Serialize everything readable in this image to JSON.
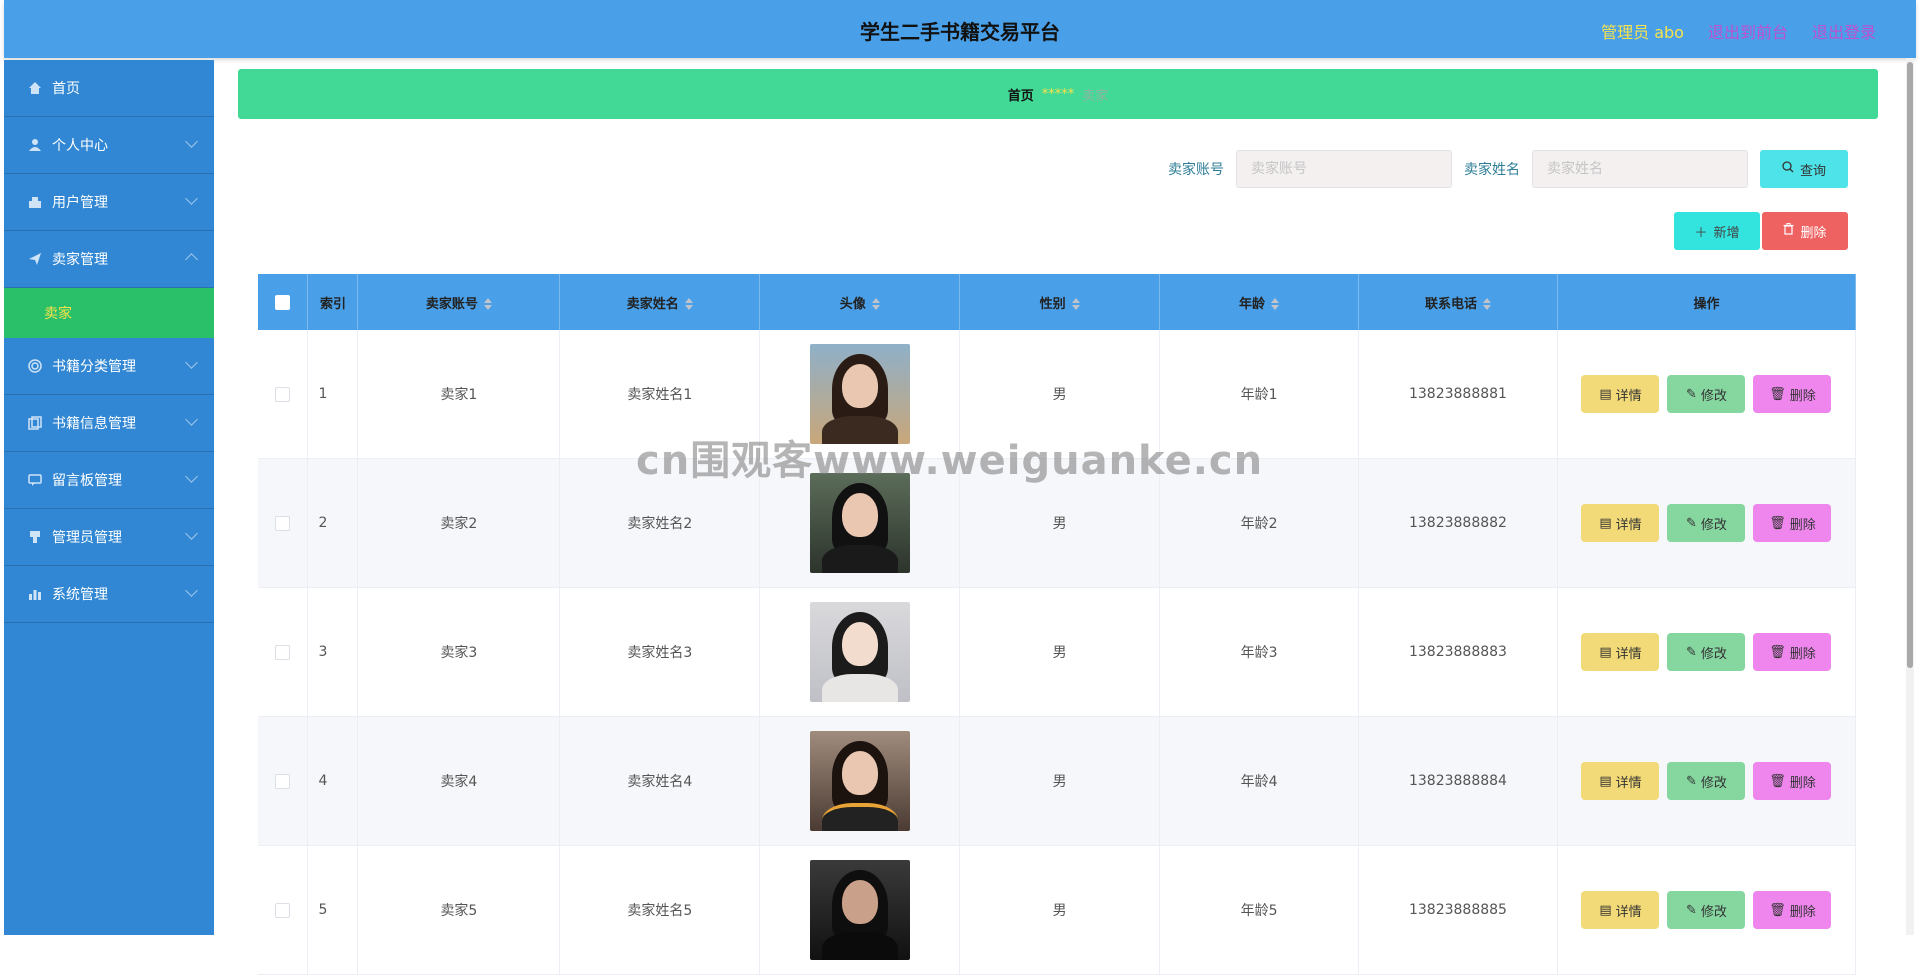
{
  "header": {
    "title": "学生二手书籍交易平台",
    "admin_label": "管理员 abo",
    "back_to_front": "退出到前台",
    "logout": "退出登录"
  },
  "sidebar": {
    "items": [
      {
        "label": "首页",
        "icon": "home-icon"
      },
      {
        "label": "个人中心",
        "icon": "user-icon"
      },
      {
        "label": "用户管理",
        "icon": "users-icon"
      },
      {
        "label": "卖家管理",
        "icon": "send-icon",
        "expanded": true
      },
      {
        "label": "书籍分类管理",
        "icon": "category-icon"
      },
      {
        "label": "书籍信息管理",
        "icon": "copy-icon"
      },
      {
        "label": "留言板管理",
        "icon": "message-icon"
      },
      {
        "label": "管理员管理",
        "icon": "admin-icon"
      },
      {
        "label": "系统管理",
        "icon": "chart-icon"
      }
    ],
    "sub_active": "卖家"
  },
  "breadcrumb": {
    "home": "首页",
    "sep": "*****",
    "current": "卖家"
  },
  "search": {
    "account_label": "卖家账号",
    "account_placeholder": "卖家账号",
    "name_label": "卖家姓名",
    "name_placeholder": "卖家姓名",
    "query_label": "查询"
  },
  "actions": {
    "add_label": "新增",
    "delete_label": "删除"
  },
  "table": {
    "headers": [
      "索引",
      "卖家账号",
      "卖家姓名",
      "头像",
      "性别",
      "年龄",
      "联系电话",
      "操作"
    ],
    "rows": [
      {
        "index": "1",
        "account": "卖家1",
        "name": "卖家姓名1",
        "gender": "男",
        "age": "年龄1",
        "phone": "13823888881"
      },
      {
        "index": "2",
        "account": "卖家2",
        "name": "卖家姓名2",
        "gender": "男",
        "age": "年龄2",
        "phone": "13823888882"
      },
      {
        "index": "3",
        "account": "卖家3",
        "name": "卖家姓名3",
        "gender": "男",
        "age": "年龄3",
        "phone": "13823888883"
      },
      {
        "index": "4",
        "account": "卖家4",
        "name": "卖家姓名4",
        "gender": "男",
        "age": "年龄4",
        "phone": "13823888884"
      },
      {
        "index": "5",
        "account": "卖家5",
        "name": "卖家姓名5",
        "gender": "男",
        "age": "年龄5",
        "phone": "13823888885"
      }
    ],
    "row_actions": {
      "detail": "详情",
      "edit": "修改",
      "remove": "删除"
    }
  },
  "watermark": "cn围观客www.weiguanke.cn"
}
